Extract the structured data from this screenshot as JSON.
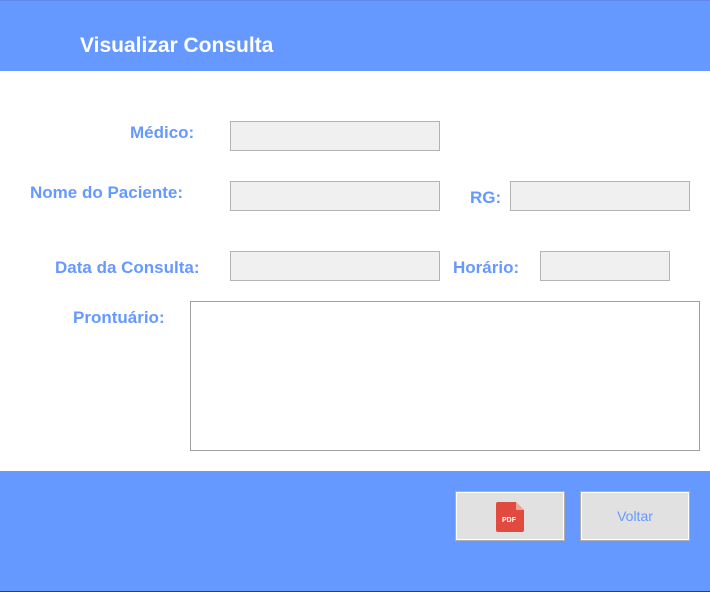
{
  "header": {
    "title": "Visualizar Consulta"
  },
  "form": {
    "medico": {
      "label": "Médico:",
      "value": ""
    },
    "paciente": {
      "label": "Nome do Paciente:",
      "value": ""
    },
    "rg": {
      "label": "RG:",
      "value": ""
    },
    "data": {
      "label": "Data da Consulta:",
      "value": ""
    },
    "horario": {
      "label": "Horário:",
      "value": ""
    },
    "prontuario": {
      "label": "Prontuário:",
      "value": ""
    }
  },
  "footer": {
    "pdf_icon_text": "PDF",
    "voltar_label": "Voltar"
  },
  "colors": {
    "accent": "#6699ff",
    "pdf_red": "#e04a3f"
  },
  "icons": {
    "pdf_button": "pdf-file-icon"
  }
}
